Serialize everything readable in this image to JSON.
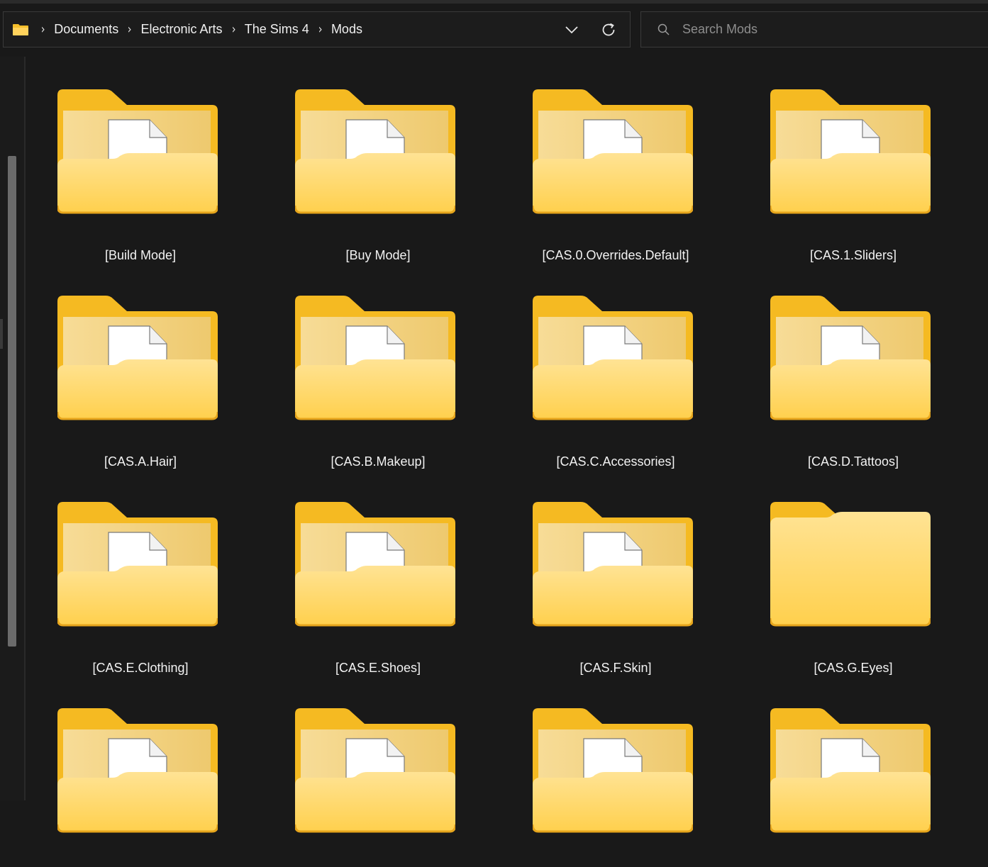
{
  "breadcrumb": {
    "items": [
      "Documents",
      "Electronic Arts",
      "The Sims 4",
      "Mods"
    ]
  },
  "address_actions": {
    "dropdown_icon": "chevron-down-icon",
    "refresh_icon": "refresh-icon"
  },
  "search": {
    "placeholder": "Search Mods"
  },
  "colors": {
    "background": "#191919",
    "folder_yellow": "#FFD25C",
    "folder_back": "#F5BE2B"
  },
  "folders": [
    {
      "name": "[Build Mode]",
      "has_files": true
    },
    {
      "name": "[Buy Mode]",
      "has_files": true
    },
    {
      "name": "[CAS.0.Overrides.Default]",
      "has_files": true
    },
    {
      "name": "[CAS.1.Sliders]",
      "has_files": true
    },
    {
      "name": "[CAS.A.Hair]",
      "has_files": true
    },
    {
      "name": "[CAS.B.Makeup]",
      "has_files": true
    },
    {
      "name": "[CAS.C.Accessories]",
      "has_files": true
    },
    {
      "name": "[CAS.D.Tattoos]",
      "has_files": true
    },
    {
      "name": "[CAS.E.Clothing]",
      "has_files": true
    },
    {
      "name": "[CAS.E.Shoes]",
      "has_files": true
    },
    {
      "name": "[CAS.F.Skin]",
      "has_files": true
    },
    {
      "name": "[CAS.G.Eyes]",
      "has_files": false
    },
    {
      "name": "",
      "has_files": true
    },
    {
      "name": "",
      "has_files": true
    },
    {
      "name": "",
      "has_files": true
    },
    {
      "name": "",
      "has_files": true
    }
  ]
}
